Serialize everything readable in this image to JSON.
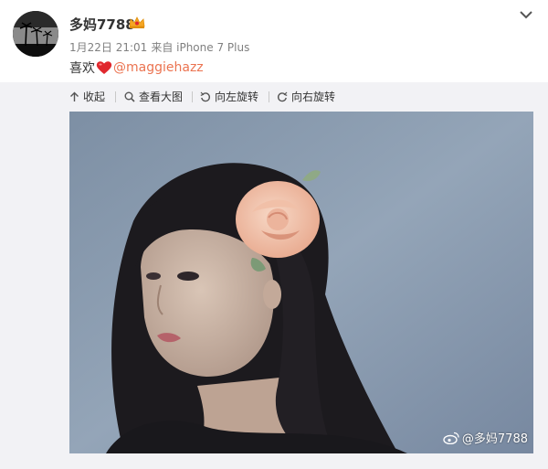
{
  "post": {
    "author": "多妈7788",
    "timestamp": "1月22日 21:01",
    "source": "来自 iPhone 7 Plus",
    "text_prefix": "喜欢",
    "mention": "@maggiehazz",
    "icons": {
      "avatar": "avatar-image",
      "vip": "vip-crown-icon",
      "heart": "heart-emoji-icon",
      "menu": "chevron-down-icon"
    }
  },
  "toolbar": {
    "collapse": "收起",
    "view_large": "查看大图",
    "rotate_left": "向左旋转",
    "rotate_right": "向右旋转"
  },
  "photo": {
    "watermark": "@多妈7788",
    "subject": "portrait-girl-with-flower"
  },
  "colors": {
    "mention": "#eb7350",
    "panel_bg": "#f2f2f5",
    "meta_text": "#808080",
    "heart": "#e0282e"
  }
}
